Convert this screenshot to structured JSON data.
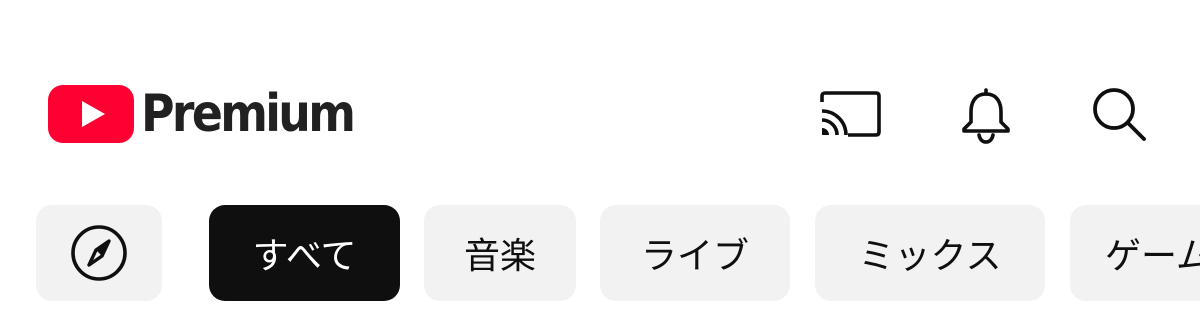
{
  "header": {
    "logo_text": "Premium",
    "actions": [
      {
        "icon": "cast-icon"
      },
      {
        "icon": "bell-icon"
      },
      {
        "icon": "search-icon"
      }
    ]
  },
  "chips": {
    "explore_icon": "compass-icon",
    "items": [
      {
        "label": "すべて",
        "selected": true
      },
      {
        "label": "音楽",
        "selected": false
      },
      {
        "label": "ライブ",
        "selected": false
      },
      {
        "label": "ミックス",
        "selected": false
      },
      {
        "label": "ゲーム",
        "selected": false
      }
    ]
  },
  "colors": {
    "brand_red": "#ff0033",
    "chip_bg": "#f2f2f2",
    "chip_selected_bg": "#0f0f0f",
    "text": "#0f0f0f"
  }
}
